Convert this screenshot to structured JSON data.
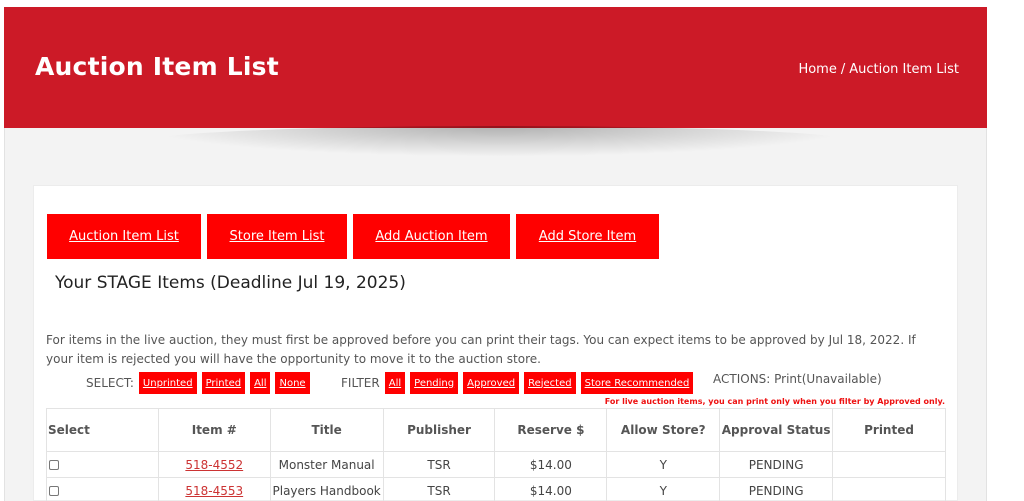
{
  "header": {
    "title": "Auction Item List",
    "breadcrumb": {
      "home": "Home",
      "separator": "/",
      "current": "Auction Item List"
    }
  },
  "nav_buttons": [
    "Auction Item List",
    "Store Item List",
    "Add Auction Item",
    "Add Store Item"
  ],
  "stage_title": "Your STAGE Items (Deadline Jul 19, 2025)",
  "info_text": "For items in the live auction, they must first be approved before you can print their tags. You can expect items to be approved by Jul 18, 2022. If your item is rejected you will have the opportunity to move it to the auction store.",
  "select": {
    "label": "SELECT:",
    "options": [
      "Unprinted",
      "Printed",
      "All",
      "None"
    ]
  },
  "filter": {
    "label": "FILTER",
    "options": [
      "All",
      "Pending",
      "Approved",
      "Rejected",
      "Store Recommended"
    ]
  },
  "actions_text": "ACTIONS: Print(Unavailable)",
  "print_note": "For live auction items, you can print only when you filter by Approved only.",
  "table": {
    "headers": [
      "Select",
      "Item #",
      "Title",
      "Publisher",
      "Reserve $",
      "Allow Store?",
      "Approval Status",
      "Printed"
    ],
    "rows": [
      {
        "item": "518-4552",
        "title": "Monster Manual",
        "publisher": "TSR",
        "reserve": "$14.00",
        "allow_store": "Y",
        "status": "PENDING",
        "printed": ""
      },
      {
        "item": "518-4553",
        "title": "Players Handbook",
        "publisher": "TSR",
        "reserve": "$14.00",
        "allow_store": "Y",
        "status": "PENDING",
        "printed": ""
      }
    ]
  },
  "colors": {
    "header_red": "#cc1a27",
    "button_red": "#ff0000",
    "link_red": "#cc3333"
  }
}
